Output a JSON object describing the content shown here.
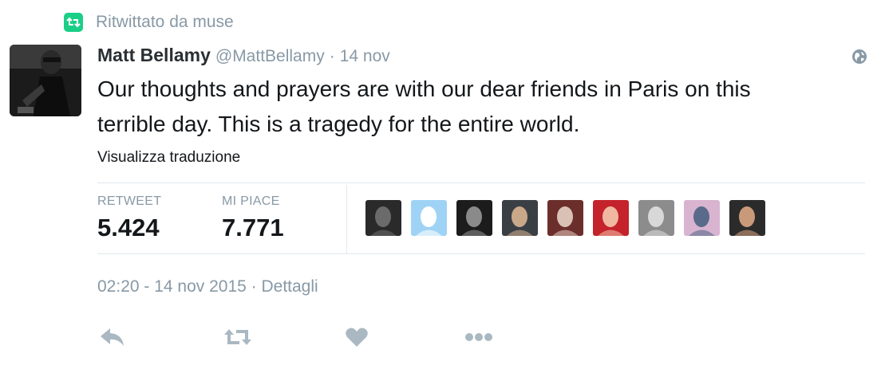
{
  "retweet_context": {
    "label": "Ritwittato da muse",
    "icon": "retweet-icon",
    "icon_color": "#19cf86"
  },
  "tweet": {
    "author": {
      "full_name": "Matt Bellamy",
      "username": "@MattBellamy"
    },
    "separator": "·",
    "relative_time": "14 nov",
    "text_lines": [
      "Our thoughts and prayers are with our dear friends in Paris on this",
      "terrible day.  This is a tragedy for the entire world."
    ],
    "translate_link": "Visualizza traduzione",
    "stats": {
      "retweets": {
        "label": "RETWEET",
        "value": "5.424"
      },
      "likes": {
        "label": "MI PIACE",
        "value": "7.771"
      }
    },
    "likers": [
      {
        "name": "liker-1",
        "colors": [
          "#2a2a2a",
          "#6b6b6b"
        ]
      },
      {
        "name": "liker-2",
        "colors": [
          "#9fd3f5",
          "#ffffff"
        ]
      },
      {
        "name": "liker-3",
        "colors": [
          "#1c1c1c",
          "#8a8a8a"
        ]
      },
      {
        "name": "liker-4",
        "colors": [
          "#3a3f45",
          "#c9a88a"
        ]
      },
      {
        "name": "liker-5",
        "colors": [
          "#6b2e2a",
          "#d9c2b5"
        ]
      },
      {
        "name": "liker-6",
        "colors": [
          "#c4232b",
          "#f0b8a0"
        ]
      },
      {
        "name": "liker-7",
        "colors": [
          "#8c8c8c",
          "#d8d8d8"
        ]
      },
      {
        "name": "liker-8",
        "colors": [
          "#d8b4d0",
          "#5a6a8a"
        ]
      },
      {
        "name": "liker-9",
        "colors": [
          "#2b2b2b",
          "#c99a7a"
        ]
      }
    ],
    "timestamp": "02:20 - 14 nov 2015 · Dettagli",
    "actions": [
      "reply-icon",
      "retweet-icon",
      "like-icon",
      "more-icon"
    ]
  },
  "colors": {
    "muted": "#8899a6",
    "text": "#14171a",
    "action_icon": "#aab8c2"
  }
}
